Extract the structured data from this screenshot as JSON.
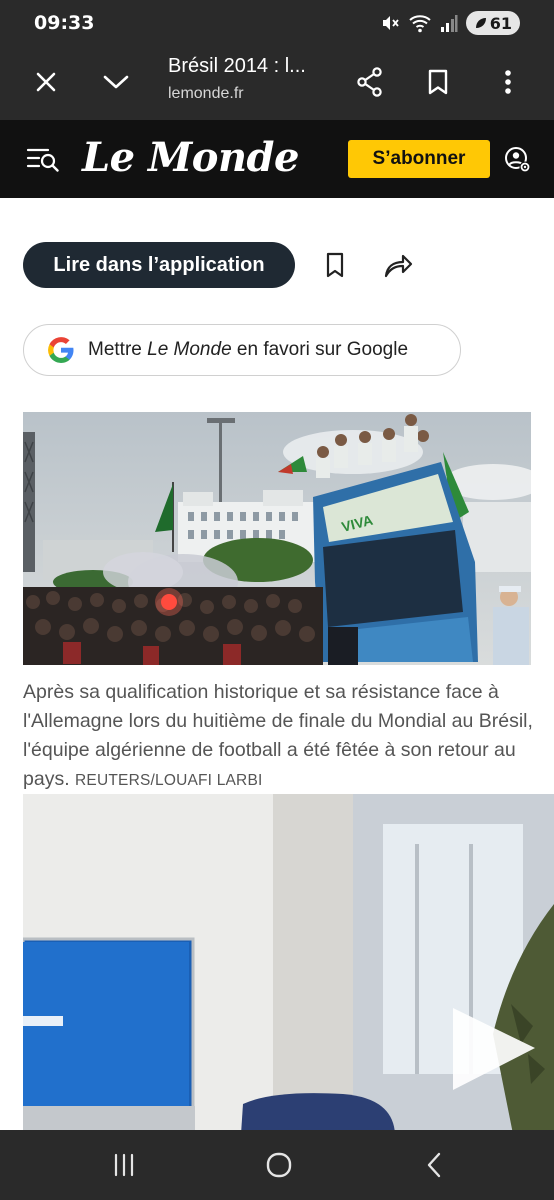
{
  "status_bar": {
    "time": "09:33",
    "battery_level": "61",
    "icons": [
      "mute-icon",
      "wifi-icon",
      "signal-icon",
      "battery-saver-icon"
    ]
  },
  "browser": {
    "tab_title": "Brésil 2014 : l...",
    "url": "lemonde.fr",
    "icons": [
      "close-icon",
      "chevron-down-icon",
      "share-icon",
      "bookmark-icon",
      "more-vert-icon"
    ]
  },
  "site_header": {
    "logo": "Le Monde",
    "subscribe_label": "S’abonner",
    "icons": [
      "menu-search-icon",
      "account-settings-icon"
    ],
    "colors": {
      "header_bg": "#111111",
      "subscribe_bg": "#ffc805"
    }
  },
  "article": {
    "open_app_label": "Lire dans l’application",
    "google_favorite": {
      "prefix": "Mettre ",
      "brand": "Le Monde",
      "suffix": " en favori sur Google"
    },
    "photo_caption": "Après sa qualification historique et sa résistance face à l'Allemagne lors du huitième de finale du Mondial au Brésil, l'équipe algérienne de football a été fêtée à son retour au pays.",
    "photo_credit": "REUTERS/LOUAFI LARBI",
    "video_play_icon": "play-icon"
  },
  "nav_bar": {
    "icons": [
      "recent-apps-icon",
      "home-icon",
      "back-icon"
    ]
  }
}
